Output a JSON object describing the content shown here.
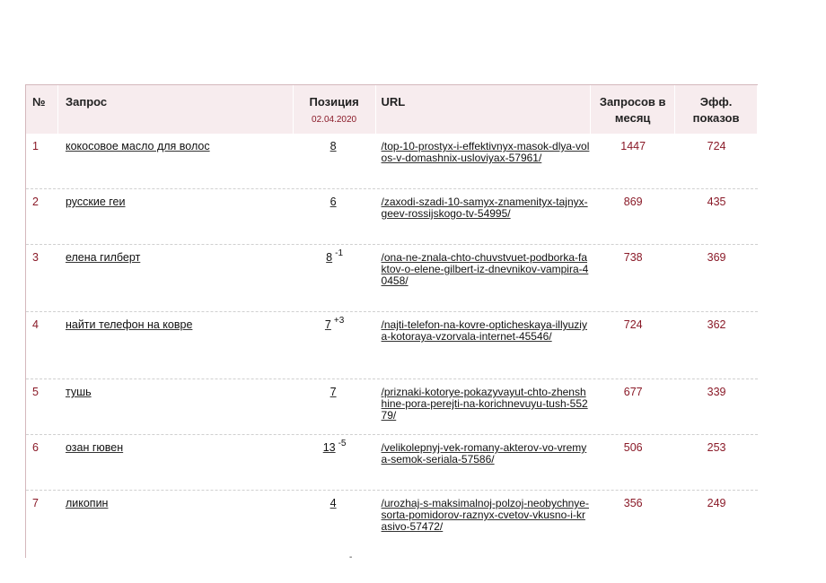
{
  "table": {
    "headers": {
      "num": "№",
      "query": "Запрос",
      "position": "Позиция",
      "position_date": "02.04.2020",
      "url": "URL",
      "requests": "Запросов в месяц",
      "effective": "Эфф. показов"
    },
    "rows": [
      {
        "num": "1",
        "query": "кокосовое масло для волос",
        "position": "8",
        "delta": "",
        "url": "/top-10-prostyx-i-effektivnyx-masok-dlya-volos-v-domashnix-usloviyax-57961/",
        "requests": "1447",
        "effective": "724"
      },
      {
        "num": "2",
        "query": "русские геи",
        "position": "6",
        "delta": "",
        "url": "/zaxodi-szadi-10-samyx-znamenityx-tajnyx-geev-rossijskogo-tv-54995/",
        "requests": "869",
        "effective": "435"
      },
      {
        "num": "3",
        "query": "елена гилберт",
        "position": "8",
        "delta": "-1",
        "url": "/ona-ne-znala-chto-chuvstvuet-podborka-faktov-o-elene-gilbert-iz-dnevnikov-vampira-40458/",
        "requests": "738",
        "effective": "369"
      },
      {
        "num": "4",
        "query": "найти телефон на ковре",
        "position": "7",
        "delta": "+3",
        "url": "/najti-telefon-na-kovre-opticheskaya-illyuziya-kotoraya-vzorvala-internet-45546/",
        "requests": "724",
        "effective": "362"
      },
      {
        "num": "5",
        "query": "тушь",
        "position": "7",
        "delta": "",
        "url": "/priznaki-kotorye-pokazyvayut-chto-zhenshhine-pora-perejti-na-korichnevuyu-tush-55279/",
        "requests": "677",
        "effective": "339"
      },
      {
        "num": "6",
        "query": "озан гювен",
        "position": "13",
        "delta": "-5",
        "url": "/velikolepnyj-vek-romany-akterov-vo-vremya-semok-seriala-57586/",
        "requests": "506",
        "effective": "253"
      },
      {
        "num": "7",
        "query": "ликопин",
        "position": "4",
        "delta": "",
        "url": "/urozhaj-s-maksimalnoj-polzoj-neobychnye-sorta-pomidorov-raznyx-cvetov-vkusno-i-krasivo-57472/",
        "requests": "356",
        "effective": "249"
      }
    ],
    "trailing_mark": "-"
  }
}
